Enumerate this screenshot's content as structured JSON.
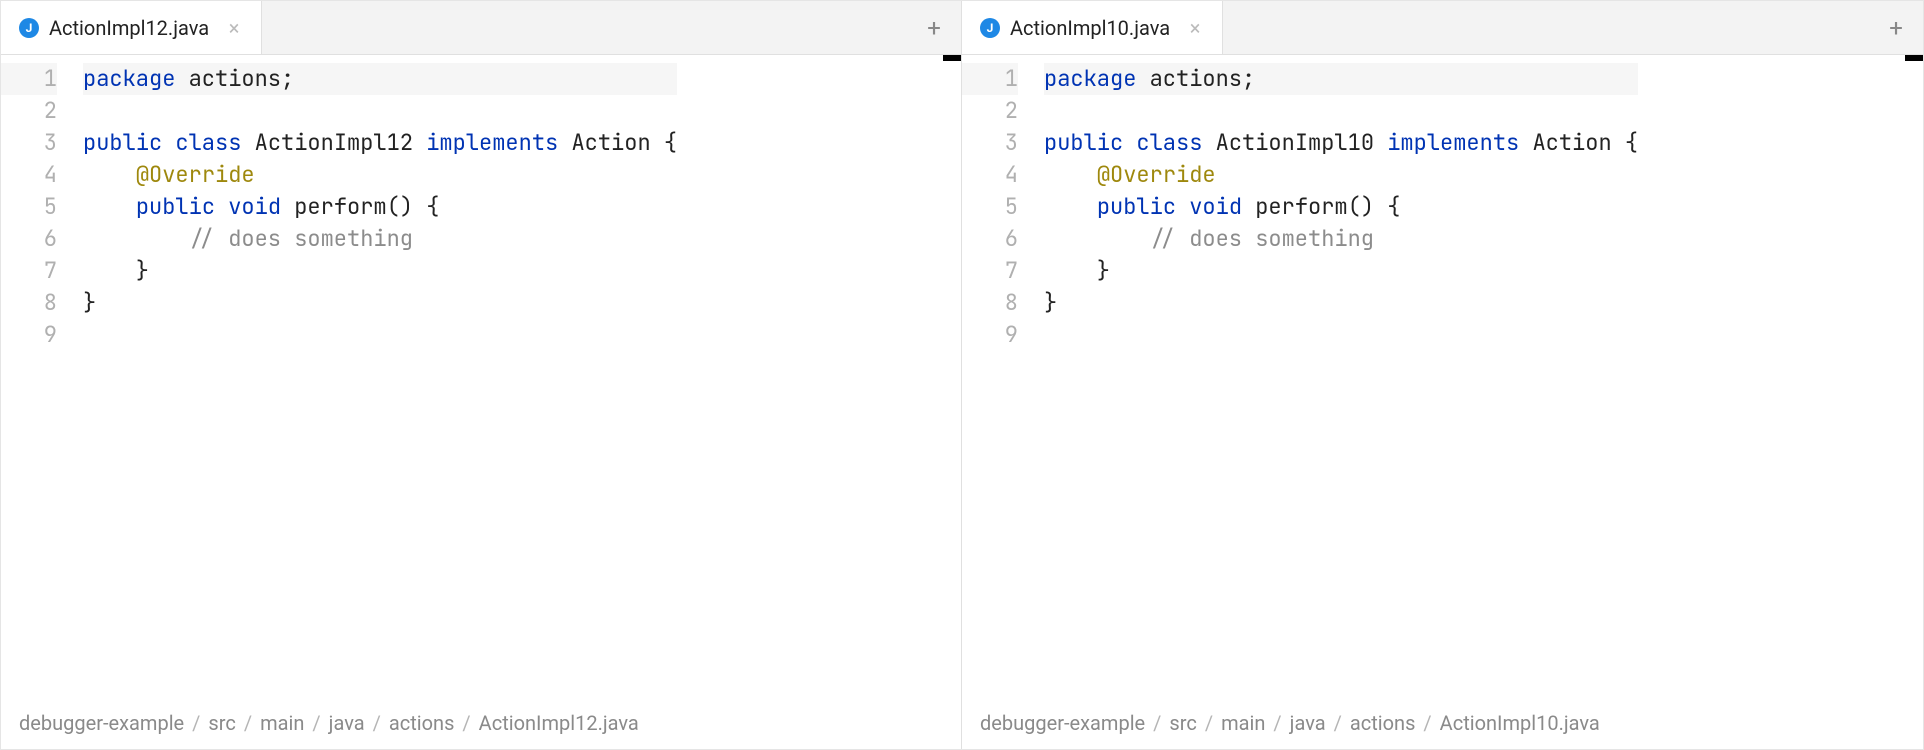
{
  "panes": [
    {
      "tab": {
        "icon_letter": "J",
        "filename": "ActionImpl12.java"
      },
      "code": {
        "highlighted_line": 1,
        "lines": [
          {
            "n": 1,
            "tokens": [
              {
                "t": "package",
                "c": "kw"
              },
              {
                "t": " actions;",
                "c": ""
              }
            ]
          },
          {
            "n": 2,
            "tokens": []
          },
          {
            "n": 3,
            "tokens": [
              {
                "t": "public",
                "c": "kw"
              },
              {
                "t": " ",
                "c": ""
              },
              {
                "t": "class",
                "c": "kw"
              },
              {
                "t": " ActionImpl12 ",
                "c": ""
              },
              {
                "t": "implements",
                "c": "kw"
              },
              {
                "t": " Action {",
                "c": ""
              }
            ]
          },
          {
            "n": 4,
            "tokens": [
              {
                "t": "    ",
                "c": ""
              },
              {
                "t": "@Override",
                "c": "ann"
              }
            ]
          },
          {
            "n": 5,
            "tokens": [
              {
                "t": "    ",
                "c": ""
              },
              {
                "t": "public",
                "c": "kw"
              },
              {
                "t": " ",
                "c": ""
              },
              {
                "t": "void",
                "c": "kw"
              },
              {
                "t": " perform() {",
                "c": ""
              }
            ]
          },
          {
            "n": 6,
            "tokens": [
              {
                "t": "        ",
                "c": ""
              },
              {
                "t": "// does something",
                "c": "cm"
              }
            ]
          },
          {
            "n": 7,
            "tokens": [
              {
                "t": "    }",
                "c": ""
              }
            ]
          },
          {
            "n": 8,
            "tokens": [
              {
                "t": "}",
                "c": ""
              }
            ]
          },
          {
            "n": 9,
            "tokens": []
          }
        ]
      },
      "breadcrumb": [
        "debugger-example",
        "src",
        "main",
        "java",
        "actions",
        "ActionImpl12.java"
      ]
    },
    {
      "tab": {
        "icon_letter": "J",
        "filename": "ActionImpl10.java"
      },
      "code": {
        "highlighted_line": 1,
        "lines": [
          {
            "n": 1,
            "tokens": [
              {
                "t": "package",
                "c": "kw"
              },
              {
                "t": " actions;",
                "c": ""
              }
            ]
          },
          {
            "n": 2,
            "tokens": []
          },
          {
            "n": 3,
            "tokens": [
              {
                "t": "public",
                "c": "kw"
              },
              {
                "t": " ",
                "c": ""
              },
              {
                "t": "class",
                "c": "kw"
              },
              {
                "t": " ActionImpl10 ",
                "c": ""
              },
              {
                "t": "implements",
                "c": "kw"
              },
              {
                "t": " Action {",
                "c": ""
              }
            ]
          },
          {
            "n": 4,
            "tokens": [
              {
                "t": "    ",
                "c": ""
              },
              {
                "t": "@Override",
                "c": "ann"
              }
            ]
          },
          {
            "n": 5,
            "tokens": [
              {
                "t": "    ",
                "c": ""
              },
              {
                "t": "public",
                "c": "kw"
              },
              {
                "t": " ",
                "c": ""
              },
              {
                "t": "void",
                "c": "kw"
              },
              {
                "t": " perform() {",
                "c": ""
              }
            ]
          },
          {
            "n": 6,
            "tokens": [
              {
                "t": "        ",
                "c": ""
              },
              {
                "t": "// does something",
                "c": "cm"
              }
            ]
          },
          {
            "n": 7,
            "tokens": [
              {
                "t": "    }",
                "c": ""
              }
            ]
          },
          {
            "n": 8,
            "tokens": [
              {
                "t": "}",
                "c": ""
              }
            ]
          },
          {
            "n": 9,
            "tokens": []
          }
        ]
      },
      "breadcrumb": [
        "debugger-example",
        "src",
        "main",
        "java",
        "actions",
        "ActionImpl10.java"
      ]
    }
  ]
}
